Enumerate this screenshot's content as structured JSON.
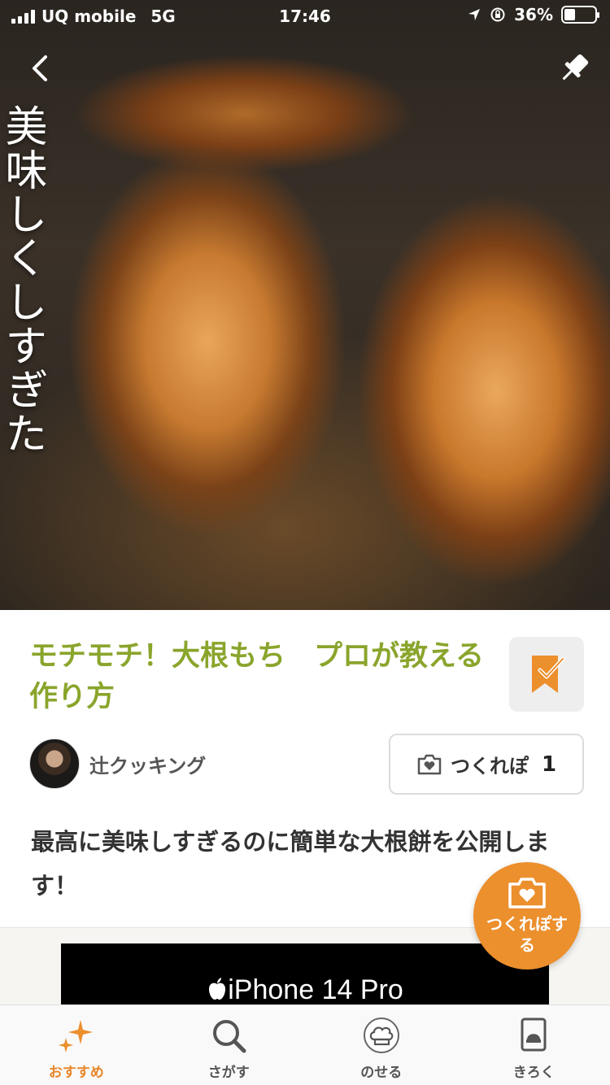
{
  "status_bar": {
    "carrier": "UQ mobile",
    "network": "5G",
    "time": "17:46",
    "battery_percent": "36%",
    "battery_level": 0.36
  },
  "hero": {
    "caption": "美味しくしすぎた",
    "back_icon": "chevron-left-icon",
    "pin_icon": "pin-icon"
  },
  "recipe": {
    "title": "モチモチ！大根もち　プロが教える作り方",
    "author_name": "辻クッキング",
    "tsukurepo_label": "つくれぽ",
    "tsukurepo_count": "1",
    "description": "最高に美味しすぎるのに簡単な大根餅を公開します！"
  },
  "fab": {
    "label": "つくれぽする"
  },
  "ad": {
    "text": "iPhone 14 Pro"
  },
  "tabs": [
    {
      "label": "おすすめ",
      "icon": "sparkle-icon",
      "active": true
    },
    {
      "label": "さがす",
      "icon": "search-icon",
      "active": false
    },
    {
      "label": "のせる",
      "icon": "chef-hat-icon",
      "active": false
    },
    {
      "label": "きろく",
      "icon": "record-card-icon",
      "active": false
    }
  ],
  "colors": {
    "accent": "#ec8f2d",
    "title_green": "#8aa52c"
  }
}
